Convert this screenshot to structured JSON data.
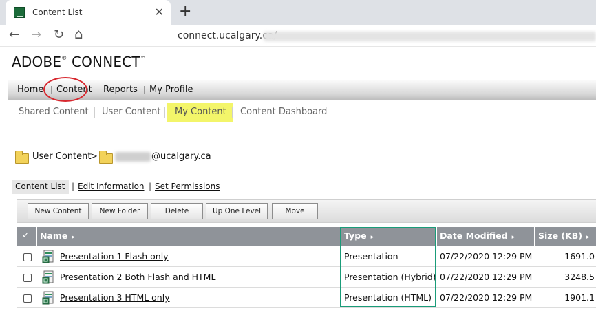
{
  "browser": {
    "tab_title": "Content List",
    "tab_close": "✕",
    "new_tab": "+",
    "back": "←",
    "forward": "→",
    "reload": "↻",
    "home": "⌂",
    "url": "connect.ucalgary.ca/"
  },
  "brand": {
    "name": "ADOBE",
    "reg": "®",
    "product": " CONNECT",
    "tm": "™"
  },
  "main_nav": {
    "items": [
      "Home",
      "Content",
      "Reports",
      "My Profile"
    ],
    "annotation_color": "#d7282f"
  },
  "sub_nav": {
    "items": [
      "Shared Content",
      "User Content",
      "My Content",
      "Content Dashboard"
    ],
    "highlight_color": "#f3f56a"
  },
  "breadcrumb": {
    "root": "User Content",
    "separator": ">",
    "user_suffix": "@ucalgary.ca"
  },
  "content_tabs": {
    "active": "Content List",
    "links": [
      "Edit Information",
      "Set Permissions"
    ],
    "separator": "|"
  },
  "toolbar": {
    "buttons": [
      "New Content",
      "New Folder",
      "Delete",
      "Up One Level",
      "Move"
    ]
  },
  "table": {
    "check_all": "✓",
    "columns": [
      "Name",
      "Type",
      "Date Modified",
      "Size (KB)"
    ],
    "sort_arrow": "▸",
    "rows": [
      {
        "name": "Presentation 1 Flash only",
        "type": "Presentation",
        "date": "07/22/2020 12:29 PM",
        "size": "1691.0"
      },
      {
        "name": "Presentation 2 Both Flash and HTML",
        "type": "Presentation (Hybrid)",
        "date": "07/22/2020 12:29 PM",
        "size": "3248.5"
      },
      {
        "name": "Presentation 3 HTML only",
        "type": "Presentation (HTML)",
        "date": "07/22/2020 12:29 PM",
        "size": "1901.1"
      }
    ],
    "annotation_color": "#1a9c79"
  },
  "icons": [
    "favicon-icon",
    "folder-icon",
    "presentation-icon"
  ]
}
